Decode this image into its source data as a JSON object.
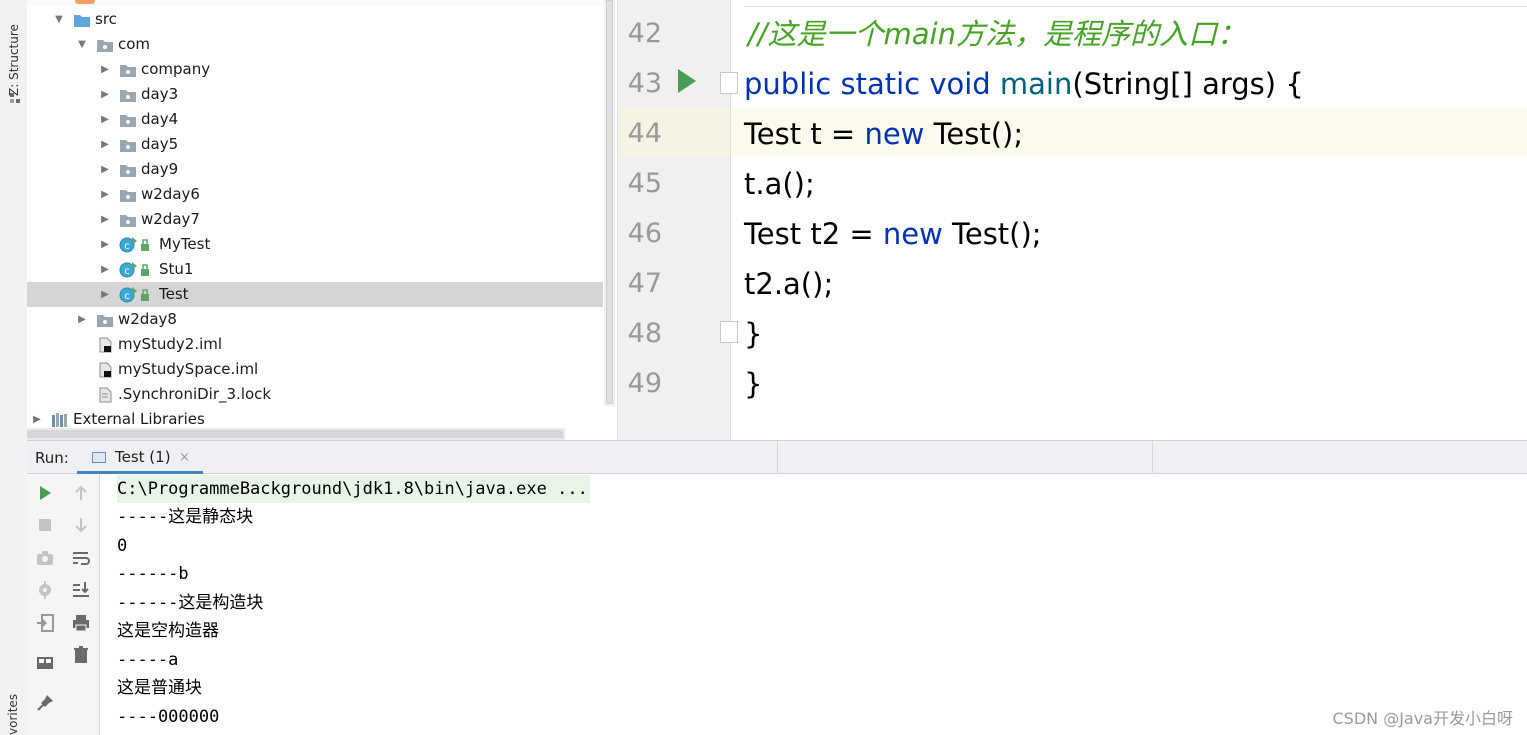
{
  "side_tabs": {
    "structure": "Z: Structure",
    "favorites": "vorites"
  },
  "project_tree": {
    "rows": [
      {
        "label": "src",
        "icon": "source-folder-icon",
        "expanded": true
      },
      {
        "label": "com",
        "icon": "package-icon",
        "expanded": true
      },
      {
        "label": "company",
        "icon": "package-icon",
        "expanded": false
      },
      {
        "label": "day3",
        "icon": "package-icon",
        "expanded": false
      },
      {
        "label": "day4",
        "icon": "package-icon",
        "expanded": false
      },
      {
        "label": "day5",
        "icon": "package-icon",
        "expanded": false
      },
      {
        "label": "day9",
        "icon": "package-icon",
        "expanded": false
      },
      {
        "label": "w2day6",
        "icon": "package-icon",
        "expanded": false
      },
      {
        "label": "w2day7",
        "icon": "package-icon",
        "expanded": false
      },
      {
        "label": "MyTest",
        "icon": "java-class-icon",
        "expanded": false
      },
      {
        "label": "Stu1",
        "icon": "java-class-icon",
        "expanded": false
      },
      {
        "label": "Test",
        "icon": "java-class-icon",
        "expanded": false,
        "selected": true
      },
      {
        "label": "w2day8",
        "icon": "package-icon",
        "expanded": false
      },
      {
        "label": "myStudy2.iml",
        "icon": "iml-file-icon"
      },
      {
        "label": "myStudySpace.iml",
        "icon": "iml-file-icon"
      },
      {
        "label": ".SynchroniDir_3.lock",
        "icon": "text-file-icon"
      },
      {
        "label": "External Libraries",
        "icon": "libraries-icon",
        "expanded": false
      }
    ]
  },
  "editor": {
    "lines": [
      {
        "num": "42"
      },
      {
        "num": "43"
      },
      {
        "num": "44"
      },
      {
        "num": "45"
      },
      {
        "num": "46"
      },
      {
        "num": "47"
      },
      {
        "num": "48"
      },
      {
        "num": "49"
      }
    ],
    "code": {
      "l42_comment": "//这是一个main方法，是程序的入口：",
      "l43_kw": "public static void",
      "l43_fn": "main",
      "l43_rest": "(String[] args) {",
      "l44_a": "Test t = ",
      "l44_kw": "new",
      "l44_b": " Test();",
      "l45": "t.a();",
      "l46_a": "Test t2 = ",
      "l46_kw": "new",
      "l46_b": " Test();",
      "l47": "t2.a();",
      "l48": " }",
      "l49": "}"
    }
  },
  "run_panel": {
    "label": "Run:",
    "tab_label": "Test (1)",
    "tab_close": "×",
    "console": [
      "C:\\ProgrammeBackground\\jdk1.8\\bin\\java.exe ...",
      "-----这是静态块",
      "0",
      "------b",
      "------这是构造块",
      "这是空构造器",
      "-----a",
      "这是普通块",
      "----000000"
    ]
  },
  "watermark": "CSDN @Java开发小白呀",
  "colors": {
    "keyword": "#0033b3",
    "method": "#00627a",
    "comment": "#46a325",
    "run_green": "#499c54",
    "tab_accent": "#4083c9"
  }
}
